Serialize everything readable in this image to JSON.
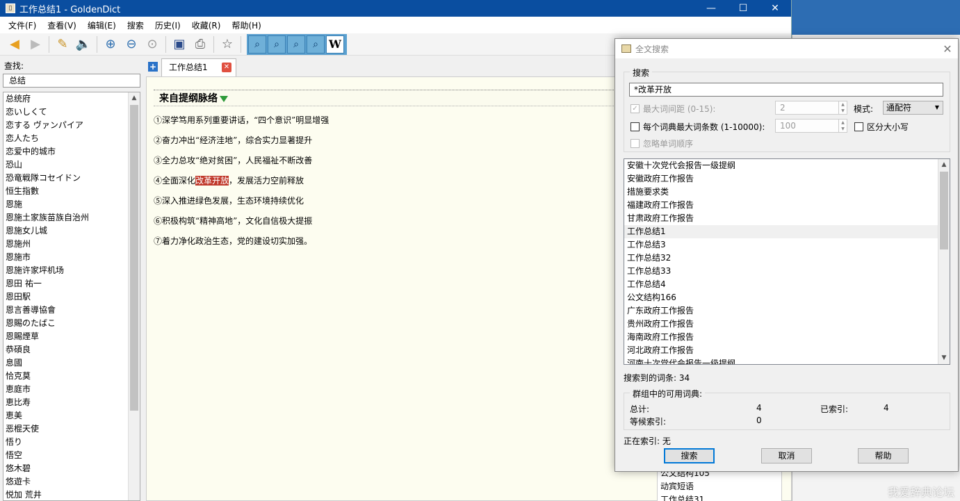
{
  "window": {
    "title": "工作总结1 - GoldenDict",
    "app_icon": "book-icon",
    "controls": [
      "minimize",
      "maximize",
      "close"
    ]
  },
  "menu": [
    "文件(F)",
    "查看(V)",
    "编辑(E)",
    "搜索",
    "历史(I)",
    "收藏(R)",
    "帮助(H)"
  ],
  "search_pane": {
    "label": "查找:",
    "query": "总结",
    "words": [
      "总统府",
      "恋いしくて",
      "恋する ヴァンパイア",
      "恋人たち",
      "恋爱中的城市",
      "恐山",
      "恐竜戦隊コセイドン",
      "恒生指數",
      "恩施",
      "恩施土家族苗族自治州",
      "恩施女儿城",
      "恩施州",
      "恩施市",
      "恩施许家坪机场",
      "恩田 祐一",
      "恩田駅",
      "恩言善導協會",
      "恩賜のたばこ",
      "恩賜煙草",
      "恭碩良",
      "息國",
      "恰克莫",
      "恵庭市",
      "恵比寿",
      "恵美",
      "恶棍天使",
      "悟り",
      "悟空",
      "悠木碧",
      "悠遊卡",
      "悦加 荒井"
    ]
  },
  "tabs": [
    {
      "label": "工作总结1"
    }
  ],
  "article": {
    "dictionary": "来自提纲脉络",
    "lines": [
      {
        "text": "①深学笃用系列重要讲话，“四个意识”明显增强"
      },
      {
        "text": "②奋力冲出“经济洼地”，综合实力显著提升"
      },
      {
        "text": "③全力总攻“绝对贫困”，人民福祉不断改善"
      },
      {
        "before": "④全面深化",
        "highlight": "改革开放",
        "after": "，发展活力空前释放"
      },
      {
        "text": "⑤深入推进绿色发展，生态环境持续优化"
      },
      {
        "text": "⑥积极构筑“精神高地”，文化自信极大提振"
      },
      {
        "text": "⑦着力净化政治生态，党的建设切实加强。"
      }
    ],
    "bottom_list": [
      "公文结构105",
      "动宾短语",
      "工作总结31"
    ]
  },
  "dialog": {
    "title": "全文搜索",
    "search_group": "搜索",
    "query": "*改革开放",
    "max_distance_label": "最大词间距 (0-15):",
    "max_distance_value": "2",
    "mode_label": "模式:",
    "mode_value": "通配符",
    "max_articles_label": "每个词典最大词条数 (1-10000):",
    "max_articles_value": "100",
    "case_sensitive_label": "区分大小写",
    "ignore_order_label": "忽略单词顺序",
    "results": [
      "安徽十次党代会报告一级提纲",
      "安徽政府工作报告",
      "措施要求类",
      "福建政府工作报告",
      "甘肃政府工作报告",
      "工作总结1",
      "工作总结3",
      "工作总结32",
      "工作总结33",
      "工作总结4",
      "公文结构166",
      "广东政府工作报告",
      "贵州政府工作报告",
      "海南政府工作报告",
      "河北政府工作报告",
      "河南十次党代会报告一级提纲"
    ],
    "selected_index": 5,
    "found_label": "搜索到的词条: 34",
    "dict_group": "群组中的可用词典:",
    "total_label": "总计:",
    "total_value": "4",
    "indexed_label": "已索引:",
    "indexed_value": "4",
    "waiting_label": "等候索引:",
    "waiting_value": "0",
    "indexing_label": "正在索引: 无",
    "buttons": {
      "search": "搜索",
      "cancel": "取消",
      "help": "帮助"
    }
  },
  "watermark": "我爱辞典论坛"
}
